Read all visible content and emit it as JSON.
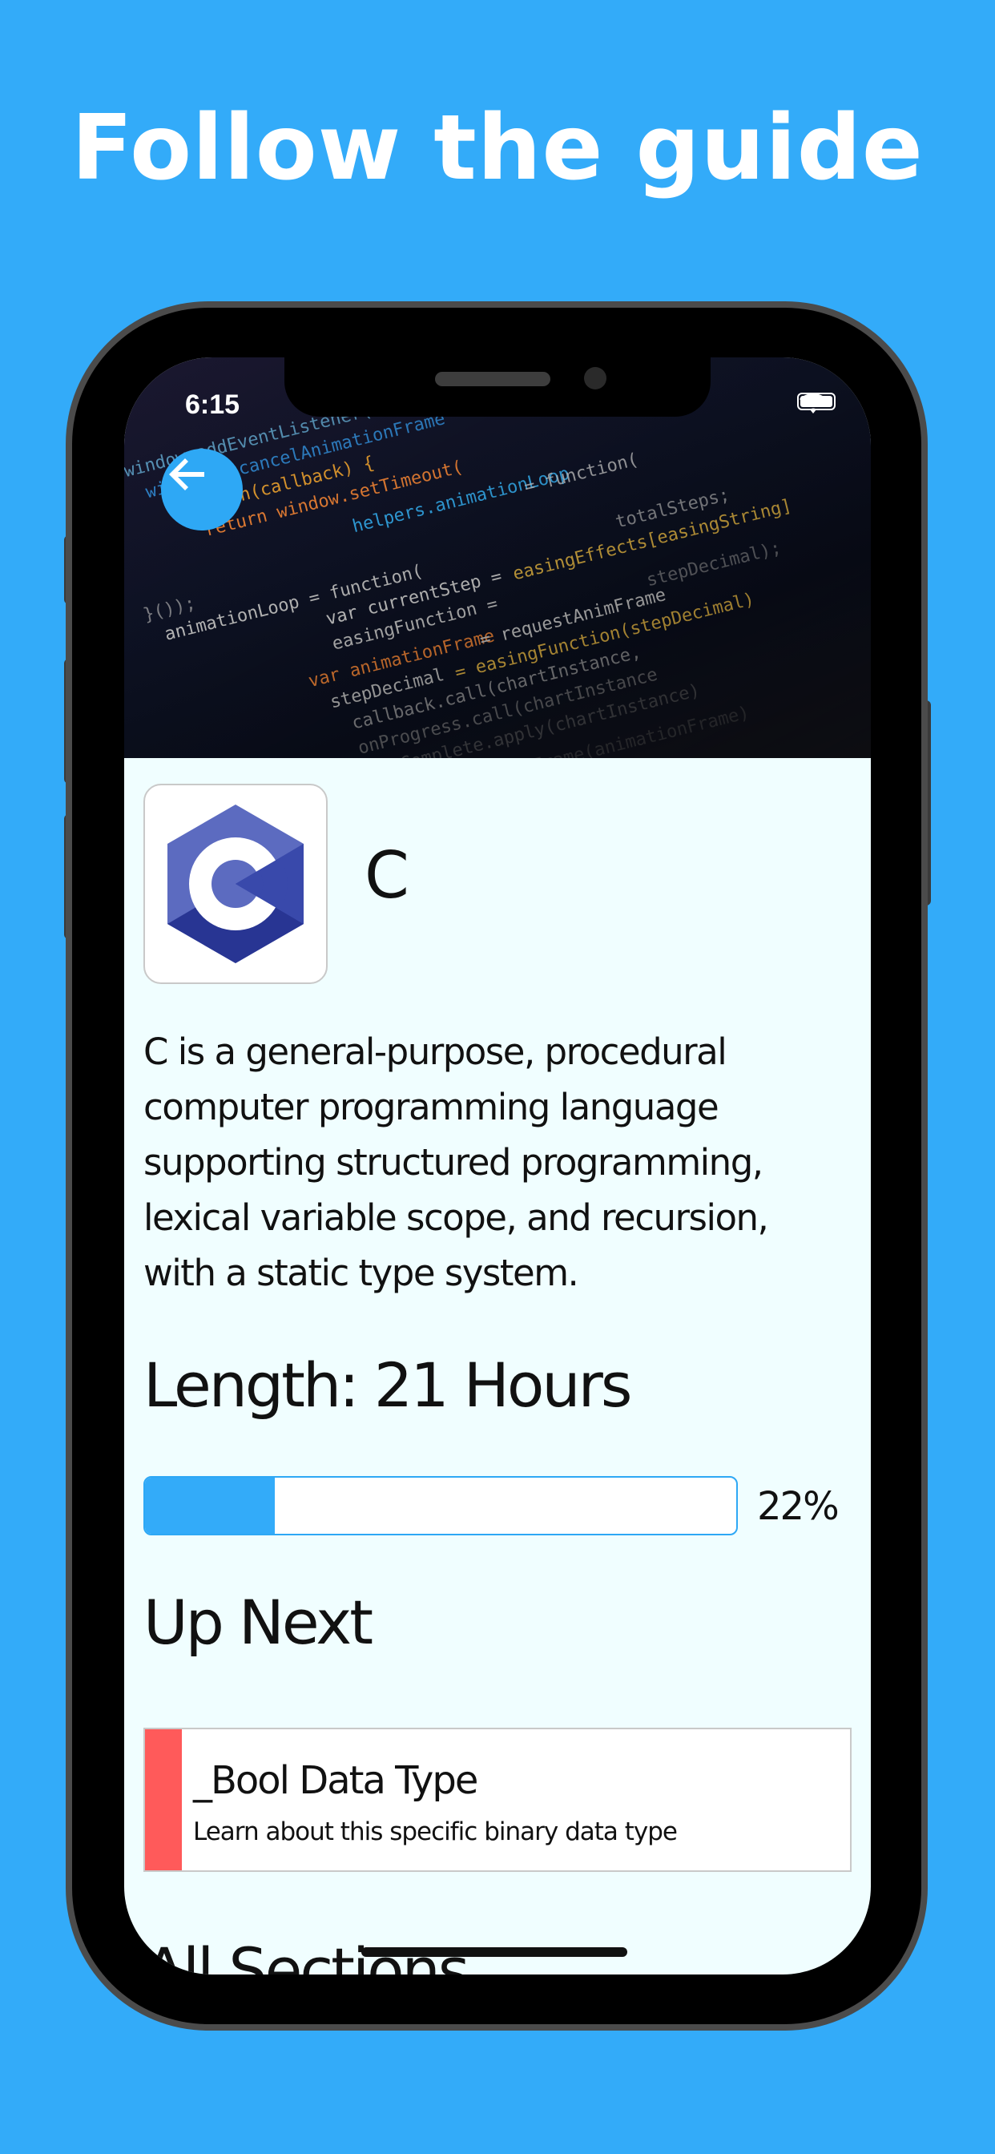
{
  "marketing": {
    "headline": "Follow the guide"
  },
  "status_bar": {
    "time": "6:15"
  },
  "icons": {
    "back": "arrow-left-icon",
    "logo": "c-language-logo",
    "wifi": "wifi-icon",
    "battery": "battery-icon"
  },
  "course": {
    "name": "C",
    "description": "C is a general-purpose, procedural computer programming language supporting structured programming, lexical variable scope, and recursion, with a static type system.",
    "length": "Length: 21 Hours",
    "progress_percent": 22,
    "progress_label": "22%"
  },
  "up_next": {
    "heading": "Up Next",
    "item": {
      "title": "_Bool Data Type",
      "subtitle": "Learn about this specific binary data type"
    }
  },
  "all_sections": {
    "heading": "All Sections"
  },
  "colors": {
    "background": "#33abf9",
    "accent": "#2ea8f5",
    "card_stripe": "#ff5a5a",
    "screen_bg": "#f0feff"
  }
}
